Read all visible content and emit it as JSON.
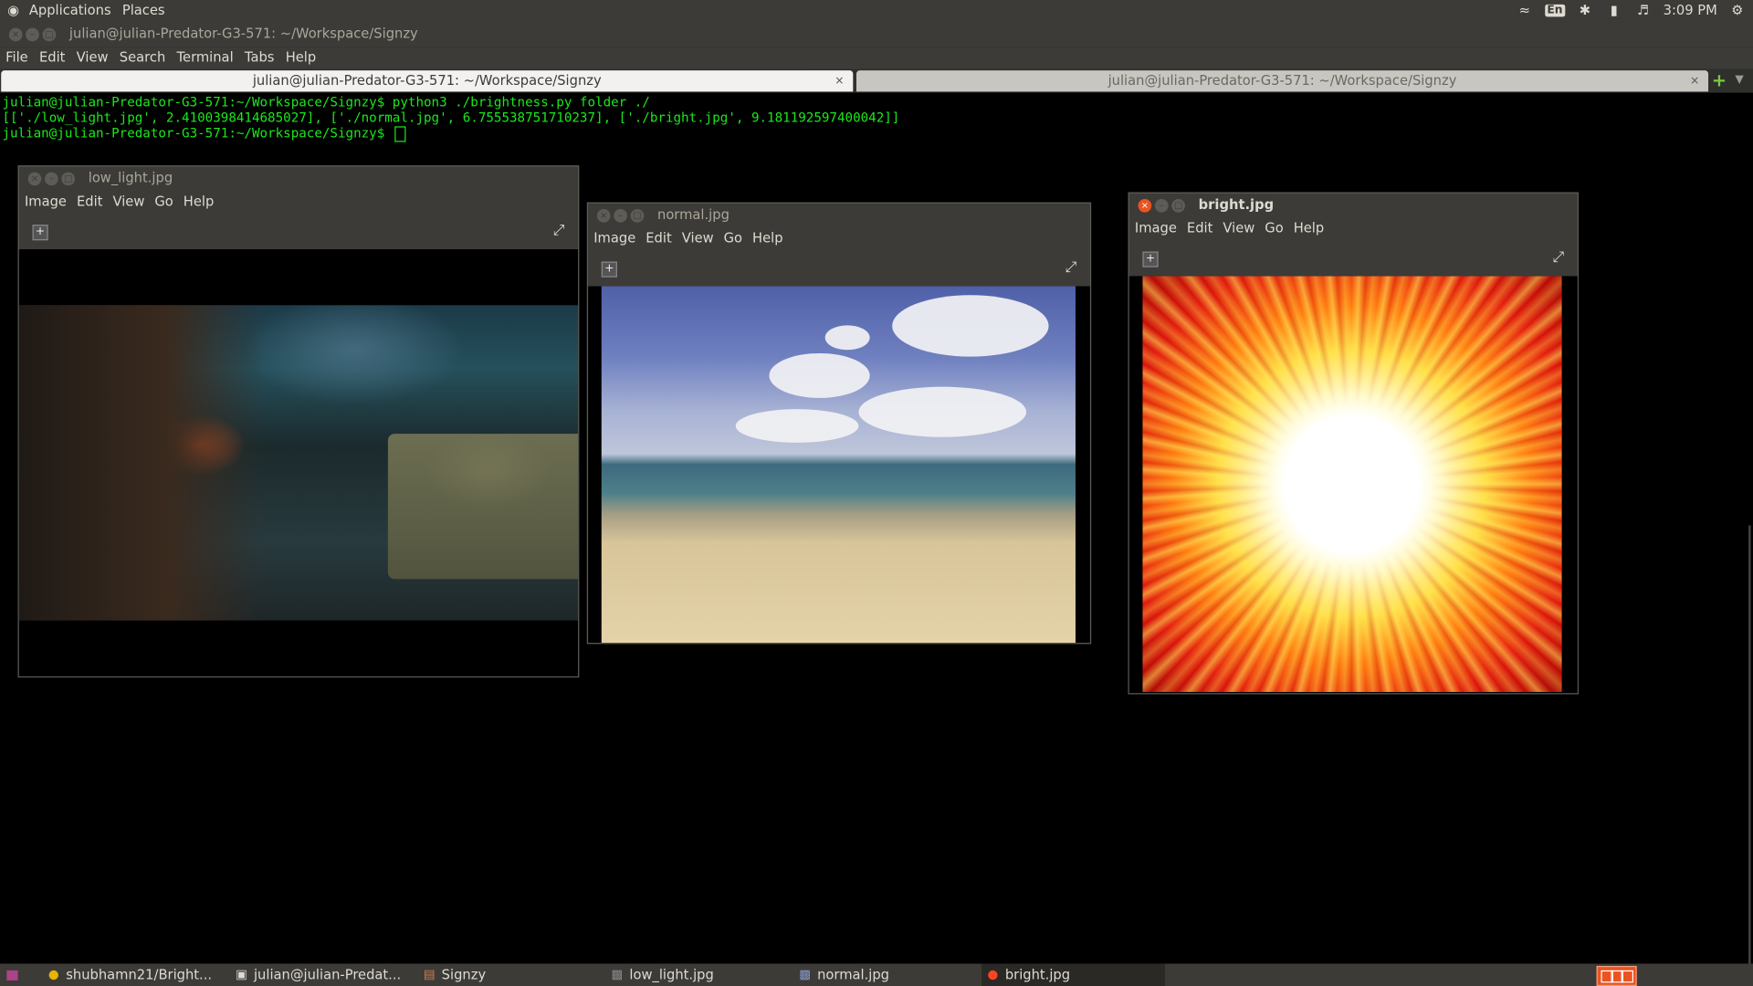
{
  "top_panel": {
    "applications": "Applications",
    "places": "Places",
    "keyboard_layout": "En",
    "clock": "3:09 PM"
  },
  "terminal": {
    "window_title": "julian@julian-Predator-G3-571: ~/Workspace/Signzy",
    "menu": [
      "File",
      "Edit",
      "View",
      "Search",
      "Terminal",
      "Tabs",
      "Help"
    ],
    "tabs": [
      {
        "label": "julian@julian-Predator-G3-571: ~/Workspace/Signzy",
        "active": true
      },
      {
        "label": "julian@julian-Predator-G3-571: ~/Workspace/Signzy",
        "active": false
      }
    ],
    "lines": [
      "julian@julian-Predator-G3-571:~/Workspace/Signzy$ python3 ./brightness.py folder ./",
      "[['./low_light.jpg', 2.4100398414685027], ['./normal.jpg', 6.755538751710237], ['./bright.jpg', 9.181192597400042]]",
      "julian@julian-Predator-G3-571:~/Workspace/Signzy$ "
    ]
  },
  "viewers": [
    {
      "title": "low_light.jpg",
      "menu": [
        "Image",
        "Edit",
        "View",
        "Go",
        "Help"
      ]
    },
    {
      "title": "normal.jpg",
      "menu": [
        "Image",
        "Edit",
        "View",
        "Go",
        "Help"
      ]
    },
    {
      "title": "bright.jpg",
      "menu": [
        "Image",
        "Edit",
        "View",
        "Go",
        "Help"
      ]
    }
  ],
  "taskbar": {
    "items": [
      {
        "label": "shubhamn21/Bright...",
        "icon": "chrome-icon"
      },
      {
        "label": "julian@julian-Predat...",
        "icon": "terminal-icon"
      },
      {
        "label": "Signzy",
        "icon": "file-manager-icon"
      },
      {
        "label": "low_light.jpg",
        "icon": "image-viewer-icon"
      },
      {
        "label": "normal.jpg",
        "icon": "image-viewer-icon"
      },
      {
        "label": "bright.jpg",
        "icon": "image-viewer-icon"
      }
    ]
  },
  "colors": {
    "panel": "#3c3b37",
    "terminal_text": "#1ce81c",
    "accent": "#e95420"
  }
}
